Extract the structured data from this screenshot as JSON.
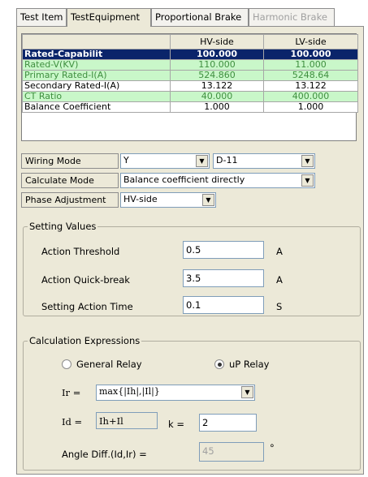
{
  "tabs": [
    {
      "label": "Test Item"
    },
    {
      "label": "TestEquipment"
    },
    {
      "label": "Proportional Brake"
    },
    {
      "label": "Harmonic Brake"
    }
  ],
  "grid": {
    "headers": [
      "",
      "HV-side",
      "LV-side"
    ],
    "rows": [
      {
        "name": "Rated-Capabilit",
        "hv": "100.000",
        "lv": "100.000"
      },
      {
        "name": "Rated-V(KV)",
        "hv": "110.000",
        "lv": "11.000"
      },
      {
        "name": "Primary Rated-I(A)",
        "hv": "524.860",
        "lv": "5248.64"
      },
      {
        "name": "Secondary Rated-I(A)",
        "hv": "13.122",
        "lv": "13.122"
      },
      {
        "name": "CT Ratio",
        "hv": "40.000",
        "lv": "400.000"
      },
      {
        "name": "Balance Coefficient",
        "hv": "1.000",
        "lv": "1.000"
      }
    ]
  },
  "wiring": {
    "label": "Wiring Mode",
    "value1": "Y",
    "value2": "D-11"
  },
  "calc_mode": {
    "label": "Calculate Mode",
    "value": "Balance coefficient directly"
  },
  "phase": {
    "label": "Phase Adjustment",
    "value": "HV-side"
  },
  "setting": {
    "title": "Setting Values",
    "threshold": {
      "label": "Action Threshold",
      "value": "0.5",
      "unit": "A"
    },
    "quickbreak": {
      "label": "Action Quick-break",
      "value": "3.5",
      "unit": "A"
    },
    "time": {
      "label": "Setting Action Time",
      "value": "0.1",
      "unit": "S"
    }
  },
  "calc": {
    "title": "Calculation Expressions",
    "general_relay": "General Relay",
    "up_relay": "uP Relay",
    "ir_label": "Ir =",
    "ir_value": "max{|Ih|,|Il|}",
    "id_label": "Id =",
    "id_value": "Ih+Il",
    "k_label": "k =",
    "k_value": "2",
    "angle_label": "Angle Diff.(Id,Ir) =",
    "angle_value": "45",
    "angle_unit": "°"
  }
}
